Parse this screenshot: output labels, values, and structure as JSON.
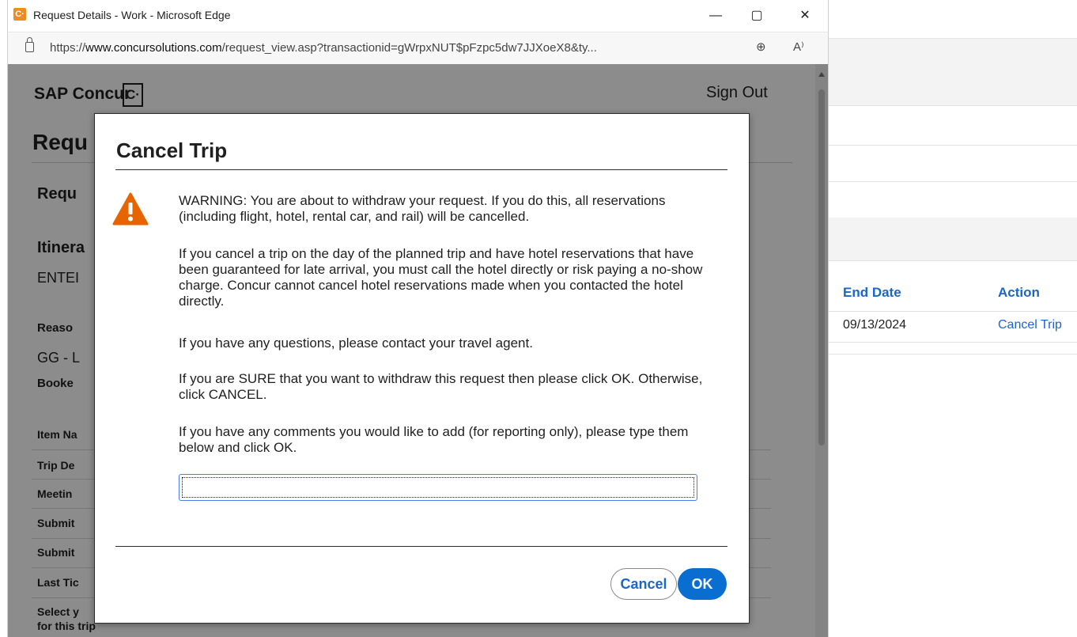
{
  "window": {
    "title": "Request Details - Work - Microsoft Edge",
    "app_icon_letter": "C·",
    "controls": {
      "minimize": "—",
      "maximize": "▢",
      "close": "✕"
    }
  },
  "address_bar": {
    "url_prefix": "https://",
    "url_domain": "www.concursolutions.com",
    "url_path": "/request_view.asp?transactionid=gWrpxNUT$pFzpc5dw7JJXoeX8&ty...",
    "zoom_icon": "⊕",
    "read_aloud_icon": "A⁾"
  },
  "page": {
    "logo_text": "SAP Concur",
    "logo_mark": "C·",
    "sign_out": "Sign Out",
    "heading": "Requ",
    "subheading": "Requ",
    "itinerary_heading": "Itinera",
    "itinerary_value": "ENTEI",
    "reason_label": "Reaso",
    "reason_value": "GG - L",
    "booked_label": "Booke",
    "rows": [
      "Item Na",
      "Trip De",
      "Meetin",
      "Submit",
      "Submit",
      "Last Tic"
    ],
    "select_label_line1": "Select y",
    "select_label_line2": "for this trip"
  },
  "background_table": {
    "headers": {
      "end_date": "End Date",
      "action": "Action"
    },
    "row": {
      "end_date": "09/13/2024",
      "action": "Cancel Trip"
    }
  },
  "modal": {
    "title": "Cancel Trip",
    "warning_icon": "warning-triangle",
    "paragraphs": [
      "WARNING: You are about to withdraw your request. If you do this, all reservations (including flight, hotel, rental car, and rail) will be cancelled.",
      "If you cancel a trip on the day of the planned trip and have hotel reservations that have been guaranteed for late arrival, you must call the hotel directly or risk paying a no-show charge. Concur cannot cancel hotel reservations made when you contacted the hotel directly.",
      "If you have any questions, please contact your travel agent.",
      "If you are SURE that you want to withdraw this request then please click OK. Otherwise, click CANCEL.",
      "If you have any comments you would like to add (for reporting only), please type them below and click OK."
    ],
    "comment_value": "",
    "cancel_label": "Cancel",
    "ok_label": "OK"
  },
  "colors": {
    "accent_blue": "#0a6ed1",
    "link_blue": "#1a66c9",
    "warning_orange": "#e76500",
    "concur_orange": "#f28b1f"
  }
}
